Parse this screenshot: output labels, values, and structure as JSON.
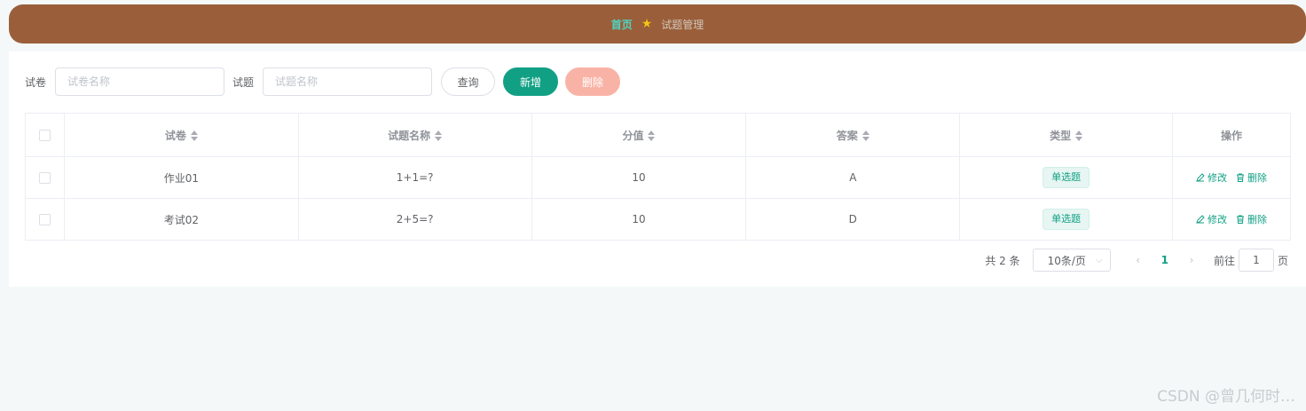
{
  "breadcrumb": {
    "home": "首页",
    "separator_icon": "star-icon",
    "current": "试题管理"
  },
  "search": {
    "paper_label": "试卷",
    "paper_placeholder": "试卷名称",
    "question_label": "试题",
    "question_placeholder": "试题名称",
    "query_button": "查询",
    "add_button": "新增",
    "delete_button": "删除"
  },
  "table": {
    "columns": [
      "试卷",
      "试题名称",
      "分值",
      "答案",
      "类型",
      "操作"
    ],
    "rows": [
      {
        "paper": "作业01",
        "question": "1+1=?",
        "score": "10",
        "answer": "A",
        "type": "单选题",
        "edit": "修改",
        "delete": "删除"
      },
      {
        "paper": "考试02",
        "question": "2+5=?",
        "score": "10",
        "answer": "D",
        "type": "单选题",
        "edit": "修改",
        "delete": "删除"
      }
    ]
  },
  "pagination": {
    "total_text": "共 2 条",
    "page_size": "10条/页",
    "current_page": "1",
    "goto_label": "前往",
    "goto_value": "1",
    "page_suffix": "页"
  },
  "watermark": "CSDN @曾几何时…",
  "colors": {
    "header": "#9a5f3a",
    "accent": "#12a085",
    "danger_light": "#f9b3a6",
    "home_link": "#4fd4c4"
  }
}
